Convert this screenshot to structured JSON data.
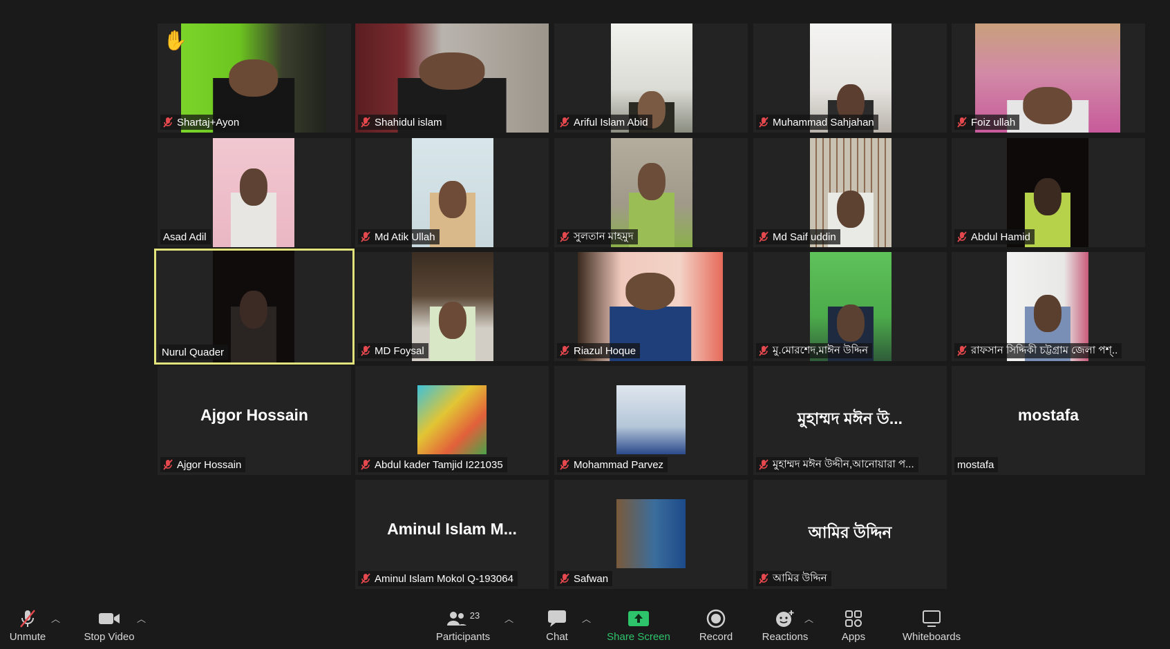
{
  "participants": [
    {
      "name": "Shartaj+Ayon",
      "muted": true,
      "hand": true
    },
    {
      "name": "Shahidul islam",
      "muted": true
    },
    {
      "name": "Ariful Islam Abid",
      "muted": true
    },
    {
      "name": "Muhammad Sahjahan",
      "muted": true
    },
    {
      "name": "Foiz ullah",
      "muted": true
    },
    {
      "name": "Asad Adil",
      "muted": false
    },
    {
      "name": "Md Atik Ullah",
      "muted": true
    },
    {
      "name": "সুলতান মাহমুদ",
      "muted": true
    },
    {
      "name": "Md Saif uddin",
      "muted": true
    },
    {
      "name": "Abdul Hamid",
      "muted": true
    },
    {
      "name": "Nurul Quader",
      "muted": false,
      "active_speaker": true
    },
    {
      "name": "MD Foysal",
      "muted": true
    },
    {
      "name": "Riazul Hoque",
      "muted": true
    },
    {
      "name": "মু.মোরশেদ,মাঈন উদ্দিন",
      "muted": true
    },
    {
      "name": "রাফসান সিদ্দিকী চট্টগ্রাম জেলা পশ্..",
      "muted": true
    },
    {
      "name": "Ajgor Hossain",
      "muted": true,
      "big_name": "Ajgor Hossain"
    },
    {
      "name": "Abdul kader Tamjid I221035",
      "muted": true
    },
    {
      "name": "Mohammad Parvez",
      "muted": true
    },
    {
      "name": "মুহাম্মদ মঈন উদ্দীন,আনোয়ারা প...",
      "muted": true,
      "big_name": "মুহাম্মদ মঈন উ..."
    },
    {
      "name": "mostafa",
      "muted": false,
      "big_name": "mostafa"
    },
    {
      "name": "Aminul Islam Mokol Q-193064",
      "muted": true,
      "big_name": "Aminul  Islam  M..."
    },
    {
      "name": "Safwan",
      "muted": true
    },
    {
      "name": "আমির উদ্দিন",
      "muted": true,
      "big_name": "আমির উদ্দিন"
    }
  ],
  "toolbar": {
    "unmute": "Unmute",
    "stop_video": "Stop Video",
    "participants": "Participants",
    "participants_count": "23",
    "chat": "Chat",
    "share_screen": "Share Screen",
    "record": "Record",
    "reactions": "Reactions",
    "apps": "Apps",
    "whiteboards": "Whiteboards"
  },
  "colors": {
    "background": "#1a1a1a",
    "tile": "#232323",
    "active_border": "#e2e37a",
    "mute_red": "#e5484d",
    "share_green": "#2ec46b"
  }
}
